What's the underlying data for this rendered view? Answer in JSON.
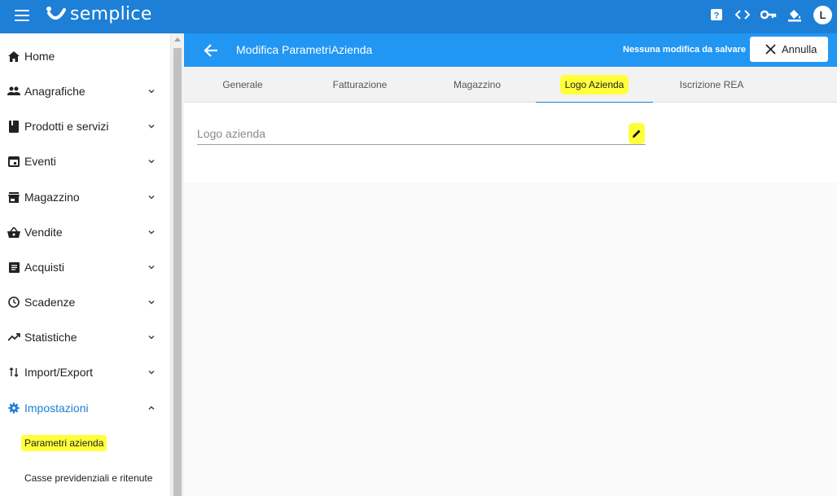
{
  "app": {
    "brand": "semplice",
    "avatar_letter": "L",
    "colors": {
      "primary": "#1e7fd6",
      "subheader": "#2196f3",
      "highlight": "#ffff3a"
    },
    "top_icons": [
      "help-icon",
      "code-icon",
      "key-icon",
      "paint-bucket-icon"
    ]
  },
  "sidebar": {
    "items": [
      {
        "label": "Home",
        "icon": "home-icon"
      },
      {
        "label": "Anagrafiche",
        "icon": "people-icon"
      },
      {
        "label": "Prodotti e servizi",
        "icon": "book-icon"
      },
      {
        "label": "Eventi",
        "icon": "calendar-icon"
      },
      {
        "label": "Magazzino",
        "icon": "store-icon"
      },
      {
        "label": "Vendite",
        "icon": "basket-icon"
      },
      {
        "label": "Acquisti",
        "icon": "list-icon"
      },
      {
        "label": "Scadenze",
        "icon": "clock-icon"
      },
      {
        "label": "Statistiche",
        "icon": "trending-up-icon"
      },
      {
        "label": "Import/Export",
        "icon": "import-export-icon"
      },
      {
        "label": "Impostazioni",
        "icon": "gear-icon"
      }
    ],
    "sub_items": [
      {
        "label": "Parametri azienda"
      },
      {
        "label": "Casse previdenziali e ritenute"
      }
    ]
  },
  "header": {
    "title": "Modifica ParametriAzienda",
    "save_status": "Nessuna modifica da salvare",
    "cancel_label": "Annulla"
  },
  "tabs": [
    {
      "label": "Generale"
    },
    {
      "label": "Fatturazione"
    },
    {
      "label": "Magazzino"
    },
    {
      "label": "Logo Azienda"
    },
    {
      "label": "Iscrizione REA"
    }
  ],
  "form": {
    "logo_field_label": "Logo azienda"
  }
}
